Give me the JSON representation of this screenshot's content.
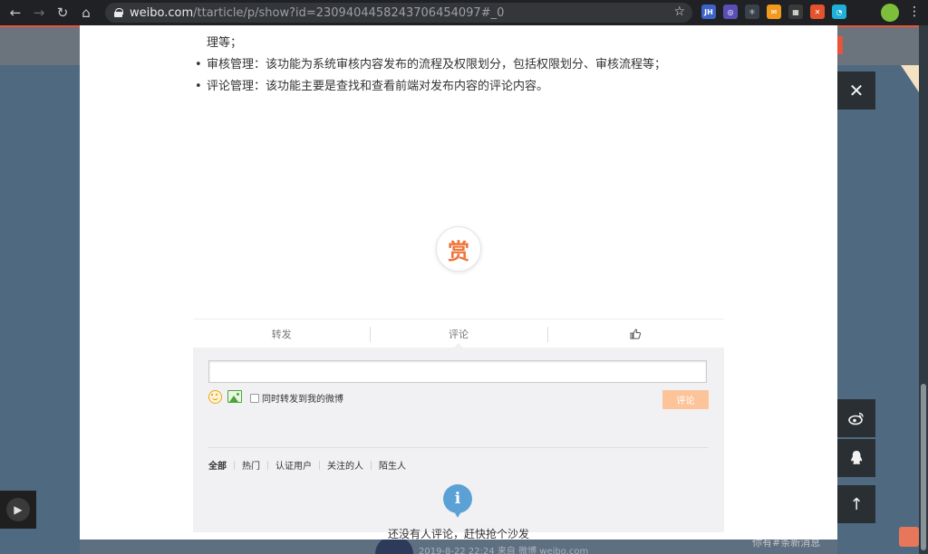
{
  "browser": {
    "url_host": "weibo.com",
    "url_path": "/ttarticle/p/show?id=2309404458243706454097#_0",
    "extensions": [
      {
        "name": "jh",
        "label": "JH",
        "color": "#3c64c8"
      },
      {
        "name": "ext-purple",
        "label": "◎",
        "color": "#5a4fb5"
      },
      {
        "name": "ext-react",
        "label": "⚛",
        "color": "#39414a"
      },
      {
        "name": "ext-orange",
        "label": "✉",
        "color": "#f29a1d"
      },
      {
        "name": "ext-qr",
        "label": "▦",
        "color": "#3a3a3a"
      },
      {
        "name": "ext-red",
        "label": "✕",
        "color": "#e4532d"
      },
      {
        "name": "ext-cyan",
        "label": "◔",
        "color": "#1fb0d9"
      }
    ]
  },
  "article": {
    "line_cont": "理等；",
    "items": [
      "审核管理：该功能为系统审核内容发布的流程及权限划分，包括权限划分、审核流程等；",
      "评论管理：该功能主要是查找和查看前端对发布内容的评论内容。"
    ]
  },
  "reward": {
    "label": "赏"
  },
  "actions": {
    "forward": "转发",
    "comment": "评论"
  },
  "comment_box": {
    "input_value": "",
    "sync_label": "同时转发到我的微博",
    "submit": "评论",
    "filters": [
      "全部",
      "热门",
      "认证用户",
      "关注的人",
      "陌生人"
    ],
    "empty_text": "还没有人评论，赶快抢个沙发"
  },
  "background": {
    "timestamp": "2019-8-22 22:24 来自 微博 weibo.com",
    "chat_text": "你有#条新消息"
  }
}
